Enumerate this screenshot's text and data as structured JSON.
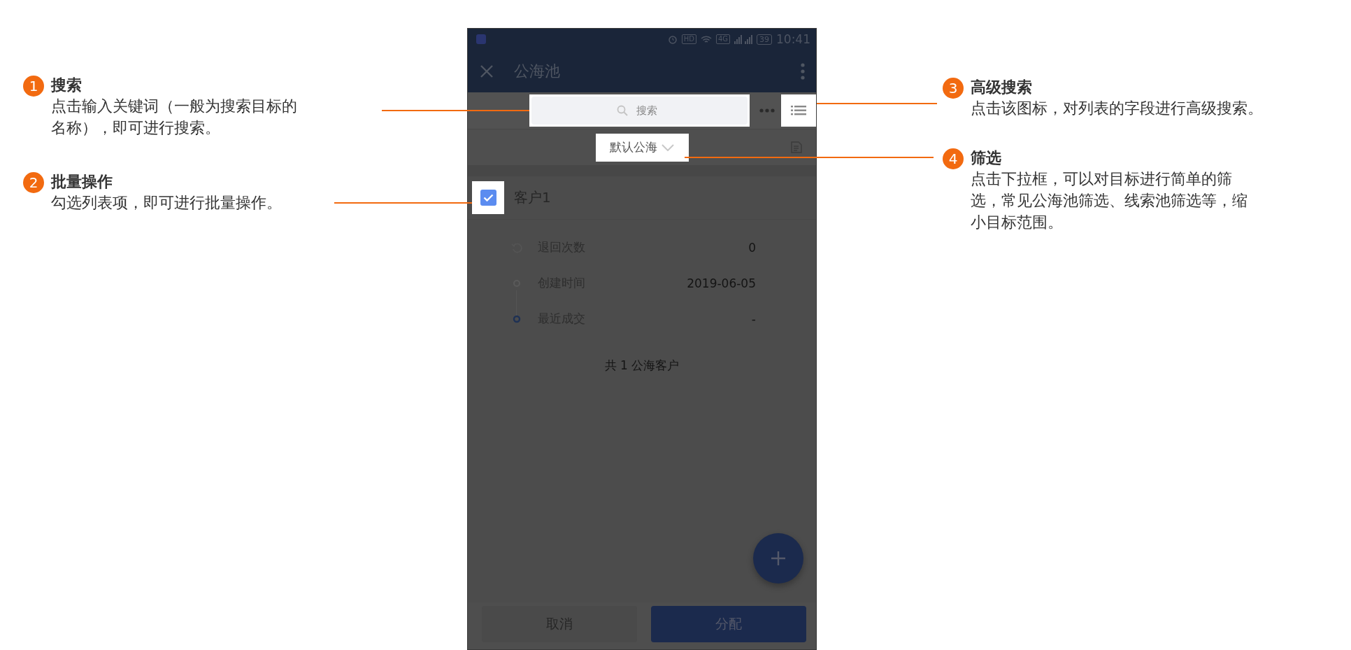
{
  "phone": {
    "status_bar": {
      "indicators": [
        "HD",
        "4G"
      ],
      "battery": "39",
      "time": "10:41"
    },
    "app_bar": {
      "title": "公海池"
    },
    "search": {
      "placeholder": "搜索"
    },
    "filter": {
      "label": "默认公海"
    },
    "records": [
      {
        "name": "客户1",
        "checked": true,
        "fields": [
          {
            "kind": "history",
            "label": "退回次数",
            "value": "0"
          },
          {
            "kind": "dot",
            "label": "创建时间",
            "value": "2019-06-05"
          },
          {
            "kind": "dot-active",
            "label": "最近成交",
            "value": "-"
          }
        ]
      }
    ],
    "footer": "共 1 公海客户",
    "buttons": [
      {
        "kind": "secondary",
        "label": "取消"
      },
      {
        "kind": "primary",
        "label": "分配"
      }
    ]
  },
  "callouts": [
    {
      "number": "1",
      "title": "搜索",
      "text": "点击输入关键词（一般为搜索目标的名称），即可进行搜索。"
    },
    {
      "number": "2",
      "title": "批量操作",
      "text": "勾选列表项，即可进行批量操作。"
    },
    {
      "number": "3",
      "title": "高级搜索",
      "text": "点击该图标，对列表的字段进行高级搜索。"
    },
    {
      "number": "4",
      "title": "筛选",
      "text": "点击下拉框，可以对目标进行简单的筛选，常见公海池筛选、线索池筛选等，缩小目标范围。"
    }
  ]
}
